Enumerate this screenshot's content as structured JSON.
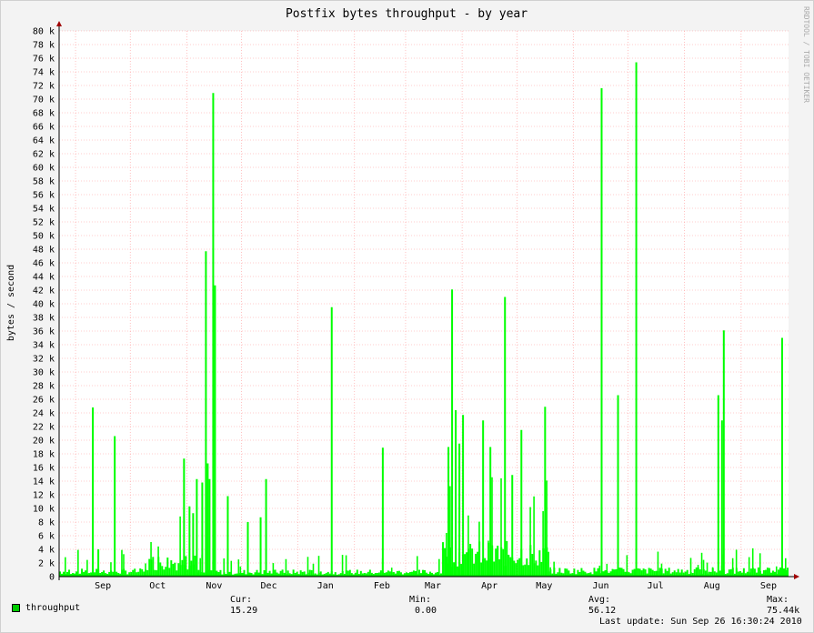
{
  "chart_data": {
    "type": "bar",
    "title": "Postfix bytes throughput - by year",
    "ylabel": "bytes / second",
    "xlabel": "",
    "watermark": "RRDTOOL / TOBI OETIKER",
    "ylim": [
      0,
      80000
    ],
    "y_ticks": [
      {
        "value": 0,
        "label": "0"
      },
      {
        "value": 2000,
        "label": "2 k"
      },
      {
        "value": 4000,
        "label": "4 k"
      },
      {
        "value": 6000,
        "label": "6 k"
      },
      {
        "value": 8000,
        "label": "8 k"
      },
      {
        "value": 10000,
        "label": "10 k"
      },
      {
        "value": 12000,
        "label": "12 k"
      },
      {
        "value": 14000,
        "label": "14 k"
      },
      {
        "value": 16000,
        "label": "16 k"
      },
      {
        "value": 18000,
        "label": "18 k"
      },
      {
        "value": 20000,
        "label": "20 k"
      },
      {
        "value": 22000,
        "label": "22 k"
      },
      {
        "value": 24000,
        "label": "24 k"
      },
      {
        "value": 26000,
        "label": "26 k"
      },
      {
        "value": 28000,
        "label": "28 k"
      },
      {
        "value": 30000,
        "label": "30 k"
      },
      {
        "value": 32000,
        "label": "32 k"
      },
      {
        "value": 34000,
        "label": "34 k"
      },
      {
        "value": 36000,
        "label": "36 k"
      },
      {
        "value": 38000,
        "label": "38 k"
      },
      {
        "value": 40000,
        "label": "40 k"
      },
      {
        "value": 42000,
        "label": "42 k"
      },
      {
        "value": 44000,
        "label": "44 k"
      },
      {
        "value": 46000,
        "label": "46 k"
      },
      {
        "value": 48000,
        "label": "48 k"
      },
      {
        "value": 50000,
        "label": "50 k"
      },
      {
        "value": 52000,
        "label": "52 k"
      },
      {
        "value": 54000,
        "label": "54 k"
      },
      {
        "value": 56000,
        "label": "56 k"
      },
      {
        "value": 58000,
        "label": "58 k"
      },
      {
        "value": 60000,
        "label": "60 k"
      },
      {
        "value": 62000,
        "label": "62 k"
      },
      {
        "value": 64000,
        "label": "64 k"
      },
      {
        "value": 66000,
        "label": "66 k"
      },
      {
        "value": 68000,
        "label": "68 k"
      },
      {
        "value": 70000,
        "label": "70 k"
      },
      {
        "value": 72000,
        "label": "72 k"
      },
      {
        "value": 74000,
        "label": "74 k"
      },
      {
        "value": 76000,
        "label": "76 k"
      },
      {
        "value": 78000,
        "label": "78 k"
      },
      {
        "value": 80000,
        "label": "80 k"
      }
    ],
    "x_range_days": [
      0,
      400
    ],
    "x_ticks": [
      {
        "label": "Sep",
        "day": 24
      },
      {
        "label": "Oct",
        "day": 54
      },
      {
        "label": "Nov",
        "day": 85
      },
      {
        "label": "Dec",
        "day": 115
      },
      {
        "label": "Jan",
        "day": 146
      },
      {
        "label": "Feb",
        "day": 177
      },
      {
        "label": "Mar",
        "day": 205
      },
      {
        "label": "Apr",
        "day": 236
      },
      {
        "label": "May",
        "day": 266
      },
      {
        "label": "Jun",
        "day": 297
      },
      {
        "label": "Jul",
        "day": 327
      },
      {
        "label": "Aug",
        "day": 358
      },
      {
        "label": "Sep",
        "day": 389
      }
    ],
    "x_gridlines_days": [
      9,
      39,
      70,
      100,
      131,
      162,
      190,
      221,
      251,
      282,
      312,
      343,
      374
    ],
    "spikes": [
      {
        "day": 18,
        "value": 24800
      },
      {
        "day": 21,
        "value": 4000
      },
      {
        "day": 30,
        "value": 20600
      },
      {
        "day": 68,
        "value": 17300
      },
      {
        "day": 71,
        "value": 10300
      },
      {
        "day": 73,
        "value": 9300
      },
      {
        "day": 75,
        "value": 14300
      },
      {
        "day": 78,
        "value": 13800
      },
      {
        "day": 80,
        "value": 47700
      },
      {
        "day": 81,
        "value": 16600
      },
      {
        "day": 82,
        "value": 14300
      },
      {
        "day": 84,
        "value": 70900
      },
      {
        "day": 85,
        "value": 42700
      },
      {
        "day": 92,
        "value": 11800
      },
      {
        "day": 103,
        "value": 8000
      },
      {
        "day": 110,
        "value": 8700
      },
      {
        "day": 113,
        "value": 14300
      },
      {
        "day": 149,
        "value": 39500
      },
      {
        "day": 177,
        "value": 18900
      },
      {
        "day": 213,
        "value": 19000
      },
      {
        "day": 215,
        "value": 42100
      },
      {
        "day": 217,
        "value": 24400
      },
      {
        "day": 219,
        "value": 19500
      },
      {
        "day": 221,
        "value": 23700
      },
      {
        "day": 232,
        "value": 22900
      },
      {
        "day": 236,
        "value": 19000
      },
      {
        "day": 244,
        "value": 41000
      },
      {
        "day": 248,
        "value": 14900
      },
      {
        "day": 253,
        "value": 21500
      },
      {
        "day": 266,
        "value": 24900
      },
      {
        "day": 297,
        "value": 71600
      },
      {
        "day": 306,
        "value": 26600
      },
      {
        "day": 316,
        "value": 75400
      },
      {
        "day": 361,
        "value": 26600
      },
      {
        "day": 363,
        "value": 22900
      },
      {
        "day": 364,
        "value": 36100
      },
      {
        "day": 396,
        "value": 35000
      }
    ],
    "baseline_bands": [
      {
        "from": 0,
        "to": 48,
        "value": 800
      },
      {
        "from": 48,
        "to": 75,
        "value": 2200
      },
      {
        "from": 75,
        "to": 210,
        "value": 700
      },
      {
        "from": 210,
        "to": 268,
        "value": 3500
      },
      {
        "from": 268,
        "to": 400,
        "value": 900
      }
    ],
    "series": [
      {
        "name": "throughput",
        "color": "#00cc00",
        "fill": "#00ff00",
        "cur": "15.29",
        "min": "0.00",
        "avg": "56.12",
        "max": "75.44k"
      }
    ]
  },
  "legend": {
    "label": "throughput",
    "cur_label": "Cur:",
    "cur_value": "15.29",
    "min_label": "Min:",
    "min_value": "0.00",
    "avg_label": "Avg:",
    "avg_value": "56.12",
    "max_label": "Max:",
    "max_value": "75.44k"
  },
  "last_update": "Last update: Sun Sep 26 16:30:24 2010"
}
